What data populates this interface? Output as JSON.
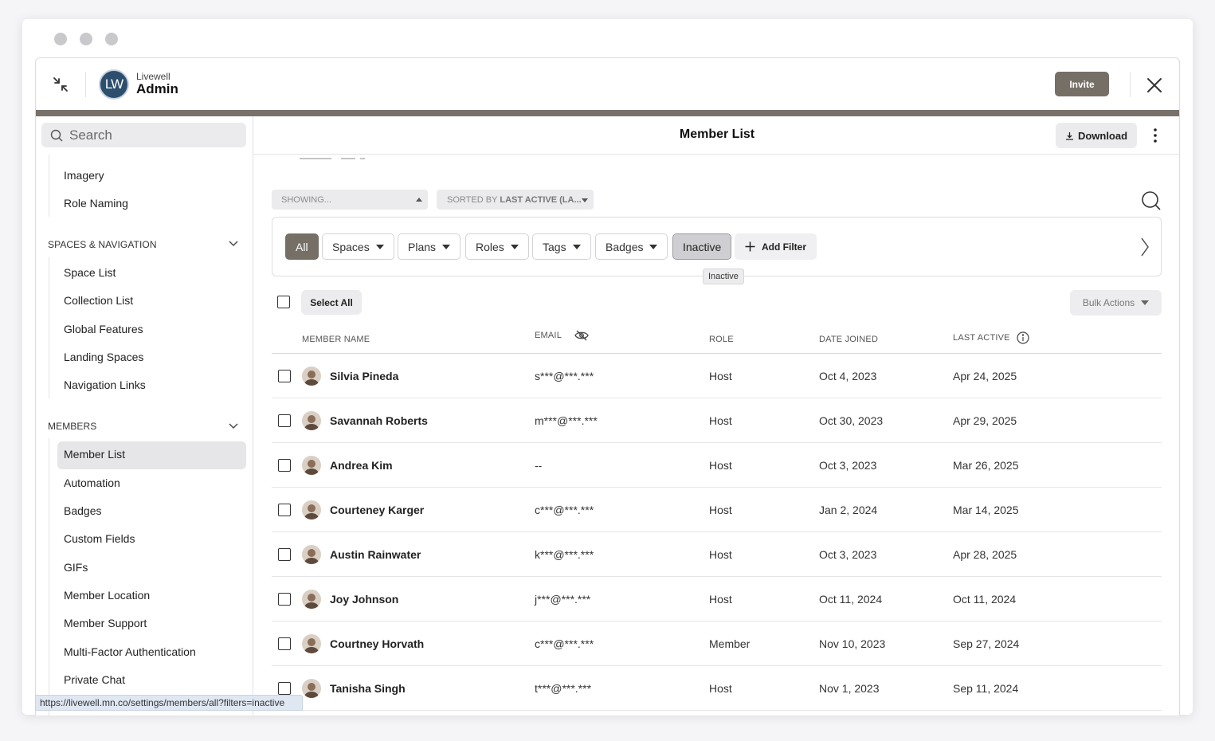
{
  "app": {
    "brand_sub": "Livewell",
    "brand_main": "Admin",
    "logo_text": "LW",
    "invite_label": "Invite"
  },
  "sidebar": {
    "search_placeholder": "Search",
    "items_top": [
      "Imagery",
      "Role Naming"
    ],
    "section_spaces": "SPACES & NAVIGATION",
    "items_spaces": [
      "Space List",
      "Collection List",
      "Global Features",
      "Landing Spaces",
      "Navigation Links"
    ],
    "section_members": "MEMBERS",
    "items_members": [
      "Member List",
      "Automation",
      "Badges",
      "Custom Fields",
      "GIFs",
      "Member Location",
      "Member Support",
      "Multi-Factor Authentication",
      "Private Chat"
    ]
  },
  "main": {
    "title": "Member List",
    "download_label": "Download",
    "showing_label": "SHOWING...",
    "sorted_prefix": "SORTED BY",
    "sorted_value": "LAST ACTIVE (LA...",
    "filters": {
      "all": "All",
      "spaces": "Spaces",
      "plans": "Plans",
      "roles": "Roles",
      "tags": "Tags",
      "badges": "Badges",
      "inactive": "Inactive",
      "add_filter": "Add Filter"
    },
    "tooltip": "Inactive",
    "select_all": "Select All",
    "bulk_actions": "Bulk Actions",
    "columns": {
      "name": "MEMBER NAME",
      "email": "EMAIL",
      "role": "ROLE",
      "joined": "DATE JOINED",
      "active": "LAST ACTIVE"
    },
    "rows": [
      {
        "name": "Silvia Pineda",
        "email": "s***@***.***",
        "role": "Host",
        "joined": "Oct 4, 2023",
        "active": "Apr 24, 2025"
      },
      {
        "name": "Savannah Roberts",
        "email": "m***@***.***",
        "role": "Host",
        "joined": "Oct 30, 2023",
        "active": "Apr 29, 2025"
      },
      {
        "name": "Andrea Kim",
        "email": "--",
        "role": "Host",
        "joined": "Oct 3, 2023",
        "active": "Mar 26, 2025"
      },
      {
        "name": "Courteney Karger",
        "email": "c***@***.***",
        "role": "Host",
        "joined": "Jan 2, 2024",
        "active": "Mar 14, 2025"
      },
      {
        "name": "Austin Rainwater",
        "email": "k***@***.***",
        "role": "Host",
        "joined": "Oct 3, 2023",
        "active": "Apr 28, 2025"
      },
      {
        "name": "Joy Johnson",
        "email": "j***@***.***",
        "role": "Host",
        "joined": "Oct 11, 2024",
        "active": "Oct 11, 2024"
      },
      {
        "name": "Courtney Horvath",
        "email": "c***@***.***",
        "role": "Member",
        "joined": "Nov 10, 2023",
        "active": "Sep 27, 2024"
      },
      {
        "name": "Tanisha Singh",
        "email": "t***@***.***",
        "role": "Host",
        "joined": "Nov 1, 2023",
        "active": "Sep 11, 2024"
      }
    ]
  },
  "status_url": "https://livewell.mn.co/settings/members/all?filters=inactive",
  "colors": {
    "accent": "#766f66",
    "brand_bar": "#77716a",
    "logo": "#2d4f6e"
  }
}
